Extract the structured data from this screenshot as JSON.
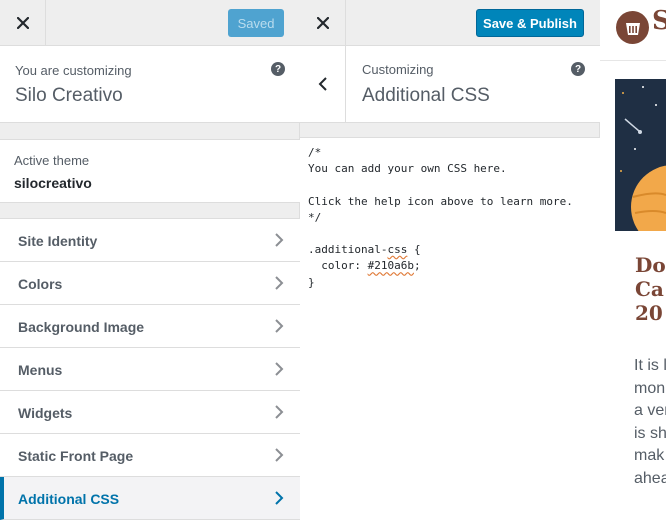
{
  "panel1": {
    "saved_label": "Saved",
    "customizing_label": "You are customizing",
    "site_name": "Silo Creativo",
    "active_theme_label": "Active theme",
    "active_theme_name": "silocreativo",
    "sections": [
      {
        "label": "Site Identity"
      },
      {
        "label": "Colors"
      },
      {
        "label": "Background Image"
      },
      {
        "label": "Menus"
      },
      {
        "label": "Widgets"
      },
      {
        "label": "Static Front Page"
      },
      {
        "label": "Additional CSS"
      }
    ]
  },
  "panel2": {
    "publish_label": "Save & Publish",
    "customizing_label": "Customizing",
    "section_title": "Additional CSS",
    "css_lines": [
      "/*",
      "You can add your own CSS here.",
      "",
      "Click the help icon above to learn more.",
      "*/",
      "",
      ".additional-",
      "  color: ",
      "}"
    ],
    "css_squiggle_1": "css",
    "css_tail_1": " {",
    "css_squiggle_2": "#210a6b",
    "css_tail_2": ";"
  },
  "preview": {
    "logo_text": "S",
    "post_title_lines": [
      "Do",
      "Ca",
      "20"
    ],
    "excerpt_lines": [
      "It is l",
      "mon",
      "a ver",
      "is sh",
      "mak",
      "ahea"
    ]
  },
  "colors": {
    "accent": "#0073aa",
    "publish_button": "#0085ba",
    "saved_button": "#4fa3d0",
    "brand": "#7a4636"
  },
  "icons": {
    "close": "close-icon",
    "help": "help-icon",
    "chevron": "chevron-right-icon",
    "back": "chevron-left-icon"
  }
}
